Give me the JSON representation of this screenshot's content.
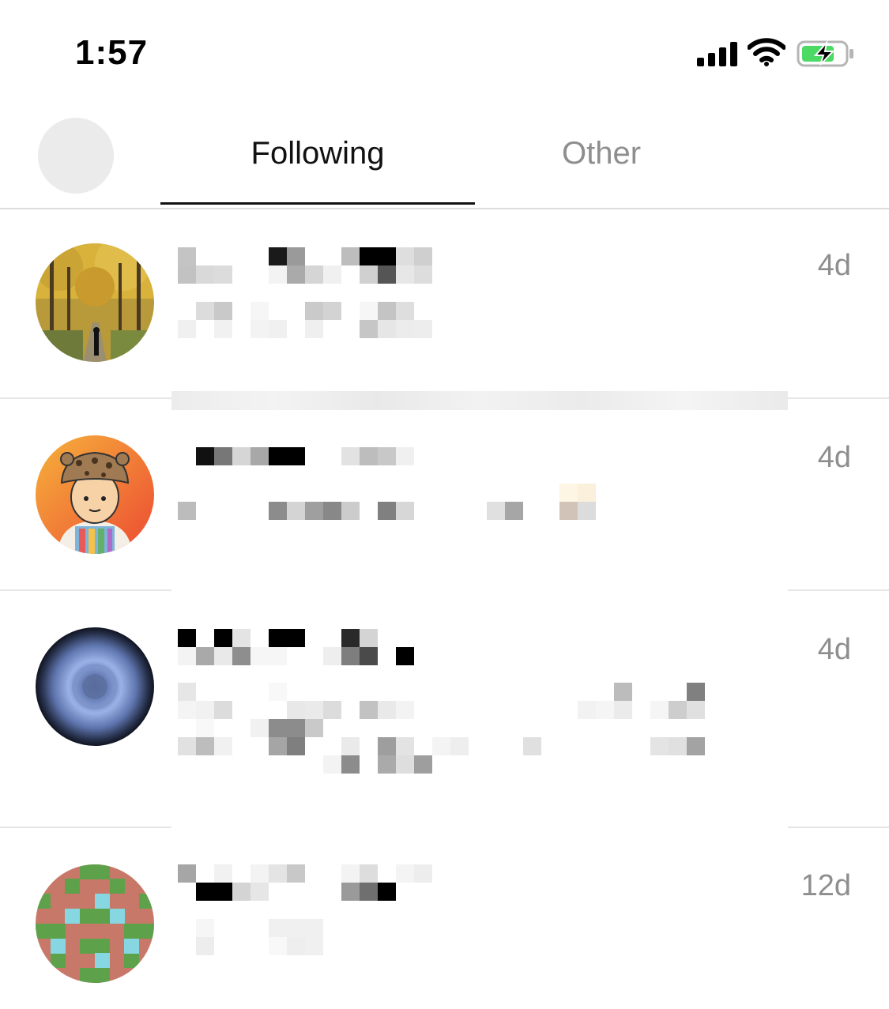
{
  "status_bar": {
    "time": "1:57",
    "icons": [
      "cellular-signal-icon",
      "wifi-icon",
      "battery-charging-icon"
    ]
  },
  "header": {
    "tabs": [
      {
        "label": "Following",
        "selected": true
      },
      {
        "label": "Other",
        "selected": false
      }
    ]
  },
  "conversations": [
    {
      "avatar": "autumn-avenue-photo",
      "time": "4d"
    },
    {
      "avatar": "cartoon-boy-in-bucket-hat",
      "time": "4d"
    },
    {
      "avatar": "blue-iris-circle",
      "time": "4d"
    },
    {
      "avatar": "pixel-pattern-tile",
      "time": "12d"
    }
  ],
  "colors": {
    "selected_tab": "#111111",
    "unselected_tab": "#8e8e8e",
    "timestamp": "#8e8e8e",
    "battery_fill": "#4cd964",
    "placeholder_avatar": "#ebebeb"
  }
}
